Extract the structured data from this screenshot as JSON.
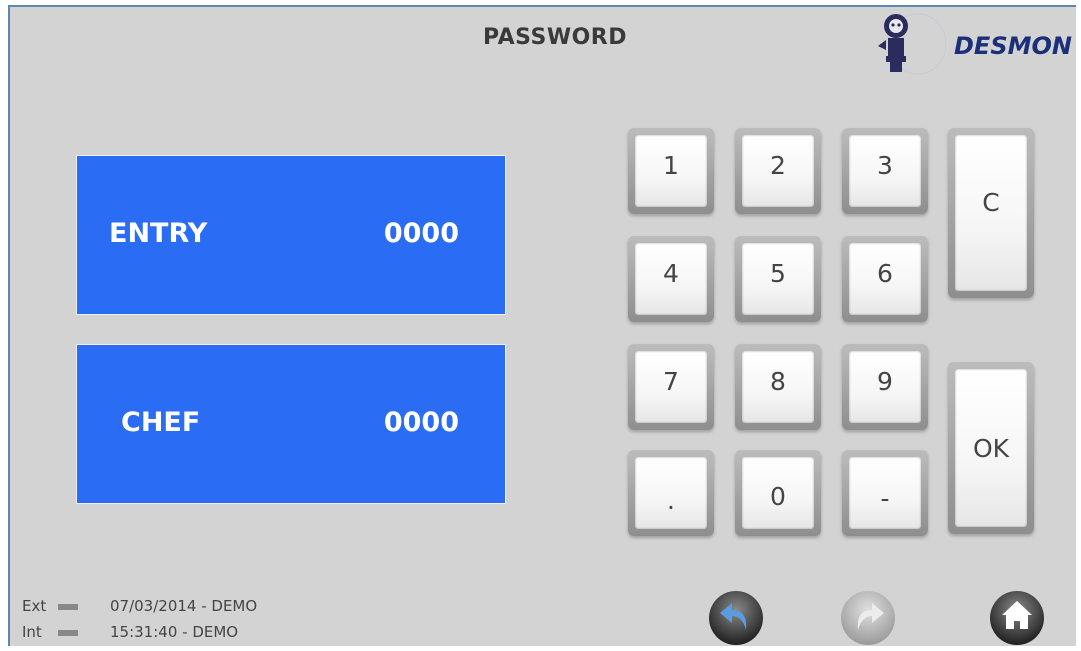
{
  "title": "PASSWORD",
  "logo": {
    "text": "DESMON"
  },
  "fields": [
    {
      "label": "ENTRY",
      "value": "0000"
    },
    {
      "label": "CHEF",
      "value": "0000"
    }
  ],
  "keypad": {
    "keys": [
      "1",
      "2",
      "3",
      "4",
      "5",
      "6",
      "7",
      "8",
      "9",
      ".",
      "0",
      "-"
    ],
    "clear_label": "C",
    "ok_label": "OK"
  },
  "status": {
    "ext": {
      "label": "Ext",
      "text": "07/03/2014 - DEMO"
    },
    "int": {
      "label": "Int",
      "text": "15:31:40 - DEMO"
    }
  },
  "nav": {
    "back_icon": "undo-arrow-icon",
    "forward_icon": "redo-arrow-icon",
    "home_icon": "home-icon"
  },
  "colors": {
    "field_blue": "#2a6cf3",
    "panel_bg": "#d3d3d3",
    "logo_text": "#1c2f7a"
  }
}
